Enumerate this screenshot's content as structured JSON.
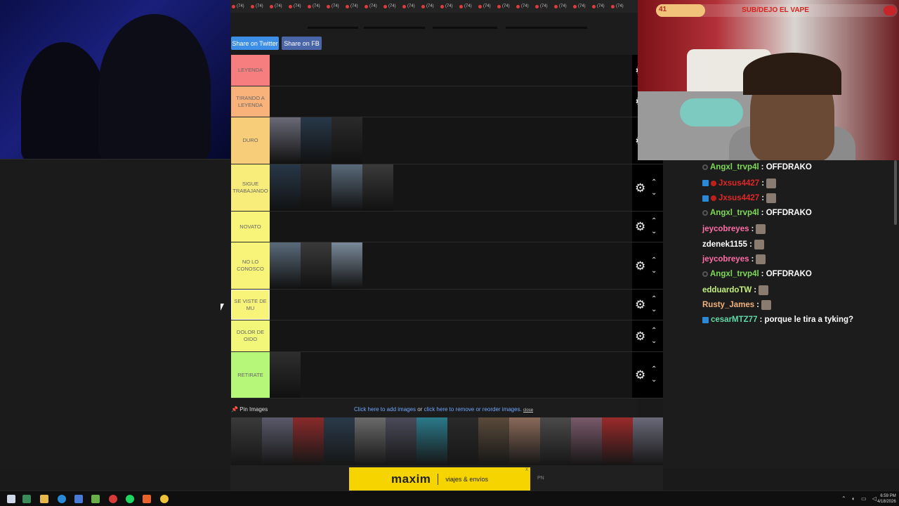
{
  "share": {
    "twitter": "Share on Twitter",
    "fb": "Share on FB"
  },
  "top_strip": {
    "item_label": "(74)",
    "count": 21
  },
  "tiers": [
    {
      "label": "LEYENDA",
      "color": "#f77e7e",
      "items": 0
    },
    {
      "label": "TIRANDO A LEYENDA",
      "color": "#f8b27a",
      "items": 0
    },
    {
      "label": "DURO",
      "color": "#f8cd7a",
      "items": 3
    },
    {
      "label": "SIGUE TRABAJANDO",
      "color": "#f8ec7a",
      "items": 4
    },
    {
      "label": "NOVATO",
      "color": "#f8f47a",
      "items": 0
    },
    {
      "label": "NO LO CONOSCO",
      "color": "#f8f47a",
      "items": 3
    },
    {
      "label": "SE VISTE DE MU",
      "color": "#f8f47a",
      "items": 0
    },
    {
      "label": "DOLOR DE OIDO",
      "color": "#f2f77a",
      "items": 0
    },
    {
      "label": "RETIRATE",
      "color": "#b6f77a",
      "items": 1
    }
  ],
  "pin": {
    "pin_label": "Pin Images",
    "add_link": "Click here to add images",
    "or_text": "or",
    "reorder_link": "click here to remove or reorder images.",
    "close_link": "close"
  },
  "ad": {
    "logo": "maxim",
    "tagline": "viajes & envíos",
    "close": "X",
    "pn": "PN"
  },
  "stream_overlay": {
    "count": "41",
    "goal": "SUB/DEJO EL VAPE"
  },
  "chat": [
    {
      "user": "Angxl_trvp4l",
      "text": ": OFFDRAKO",
      "color": "u-green",
      "badges": [
        "grey"
      ],
      "emote": false
    },
    {
      "user": "Jxsus4427",
      "text": ":",
      "color": "u-red",
      "badges": [
        "blue",
        "red"
      ],
      "emote": true
    },
    {
      "user": "Jxsus4427",
      "text": ":",
      "color": "u-red",
      "badges": [
        "blue",
        "red"
      ],
      "emote": true
    },
    {
      "user": "Angxl_trvp4l",
      "text": ": OFFDRAKO",
      "color": "u-green",
      "badges": [
        "grey"
      ],
      "emote": false
    },
    {
      "user": "jeycobreyes",
      "text": ":",
      "color": "u-pink",
      "badges": [],
      "emote": true
    },
    {
      "user": "zdenek1155",
      "text": ":",
      "color": "u-white",
      "badges": [],
      "emote": true
    },
    {
      "user": "jeycobreyes",
      "text": ":",
      "color": "u-pink",
      "badges": [],
      "emote": true
    },
    {
      "user": "Angxl_trvp4l",
      "text": ": OFFDRAKO",
      "color": "u-green",
      "badges": [
        "grey"
      ],
      "emote": false
    },
    {
      "user": "edduardoTW",
      "text": ":",
      "color": "u-lime",
      "badges": [],
      "emote": true
    },
    {
      "user": "Rusty_James",
      "text": ":",
      "color": "u-orange",
      "badges": [],
      "emote": true
    },
    {
      "user": "cesarMTZ77",
      "text": ": porque le tira a tyking?",
      "color": "u-mint",
      "badges": [
        "blue"
      ],
      "emote": false
    }
  ],
  "taskbar": {
    "time": "6:59 PM",
    "date": "4/18/2026"
  }
}
